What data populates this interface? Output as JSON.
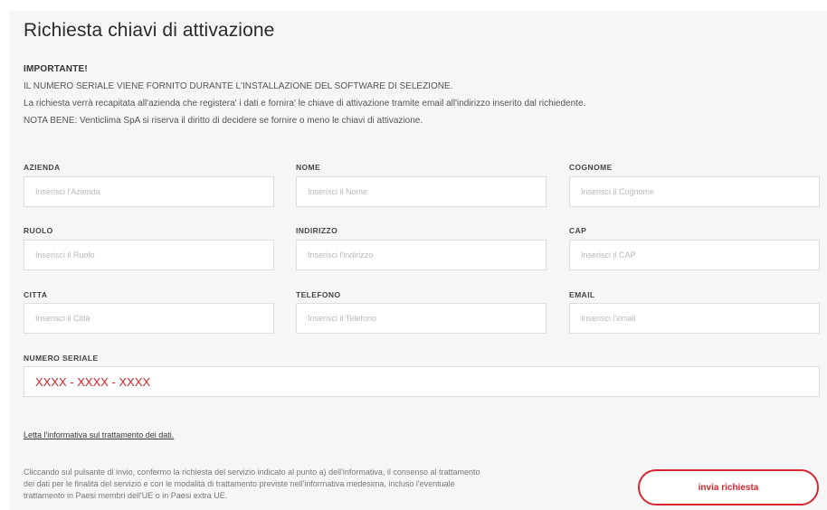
{
  "form": {
    "title": "Richiesta chiavi di attivazione",
    "notice": {
      "heading": "IMPORTANTE!",
      "line1": "IL NUMERO SERIALE VIENE FORNITO DURANTE L'INSTALLAZIONE DEL SOFTWARE DI SELEZIONE.",
      "line2": "La richiesta verrà recapitata all'azienda che registera' i dati e fornira' le chiave di attivazione tramite email all'indirizzo inserito dal richiedente.",
      "line3": "NOTA BENE: Venticlima SpA si riserva il diritto di decidere se fornire o meno le chiavi di attivazione."
    },
    "fields": {
      "azienda": {
        "label": "AZIENDA",
        "placeholder": "Inserisci l'Azienda",
        "value": ""
      },
      "nome": {
        "label": "NOME",
        "placeholder": "Inserisci il Nome",
        "value": ""
      },
      "cognome": {
        "label": "COGNOME",
        "placeholder": "Inserisci il Cognome",
        "value": ""
      },
      "ruolo": {
        "label": "RUOLO",
        "placeholder": "Inserisci il Ruolo",
        "value": ""
      },
      "indirizzo": {
        "label": "INDIRIZZO",
        "placeholder": "Inserisci l'indirizzo",
        "value": ""
      },
      "cap": {
        "label": "CAP",
        "placeholder": "Inserisci il CAP",
        "value": ""
      },
      "citta": {
        "label": "CITTA",
        "placeholder": "Inserisci il Città",
        "value": ""
      },
      "telefono": {
        "label": "TELEFONO",
        "placeholder": "Inserisci il Telefono",
        "value": ""
      },
      "email": {
        "label": "EMAIL",
        "placeholder": "Inserisci l'email",
        "value": ""
      },
      "serial": {
        "label": "NUMERO SERIALE",
        "placeholder": "XXXX - XXXX - XXXX",
        "value": ""
      }
    },
    "privacy_link": "Letta l'informativa sul trattamento dei dati.",
    "consent": {
      "line1": "Cliccando sul pulsante di invio, confermo la richiesta del servizio indicato al punto a) dell'informativa, il consenso al trattamento",
      "line2": "dei dati per le finalità del servizio e con le modalità di trattamento previste nell'informativa medesima, incluso l'eventuale",
      "line3": "trattamento in Paesi membri dell'UE o in Paesi extra UE."
    },
    "submit_label": "invia richiesta"
  },
  "colors": {
    "accent": "#d7262e",
    "panel_background": "#f6f6f6",
    "input_border": "#dedede"
  }
}
